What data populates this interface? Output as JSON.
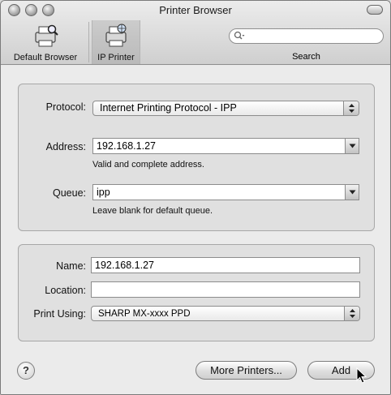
{
  "window": {
    "title": "Printer Browser"
  },
  "toolbar": {
    "items": [
      {
        "label": "Default Browser",
        "icon": "printer-magnifier-icon"
      },
      {
        "label": "IP Printer",
        "icon": "printer-globe-icon",
        "selected": true
      }
    ],
    "search": {
      "label": "Search",
      "value": "",
      "placeholder": ""
    }
  },
  "form": {
    "protocol": {
      "label": "Protocol:",
      "value": "Internet Printing Protocol - IPP"
    },
    "address": {
      "label": "Address:",
      "value": "192.168.1.27",
      "hint": "Valid and complete address."
    },
    "queue": {
      "label": "Queue:",
      "value": "ipp",
      "hint": "Leave blank for default queue."
    },
    "name": {
      "label": "Name:",
      "value": "192.168.1.27"
    },
    "location": {
      "label": "Location:",
      "value": ""
    },
    "print_using": {
      "label": "Print Using:",
      "value": "SHARP MX-xxxx PPD"
    }
  },
  "buttons": {
    "help": "?",
    "more_printers": "More Printers...",
    "add": "Add"
  }
}
